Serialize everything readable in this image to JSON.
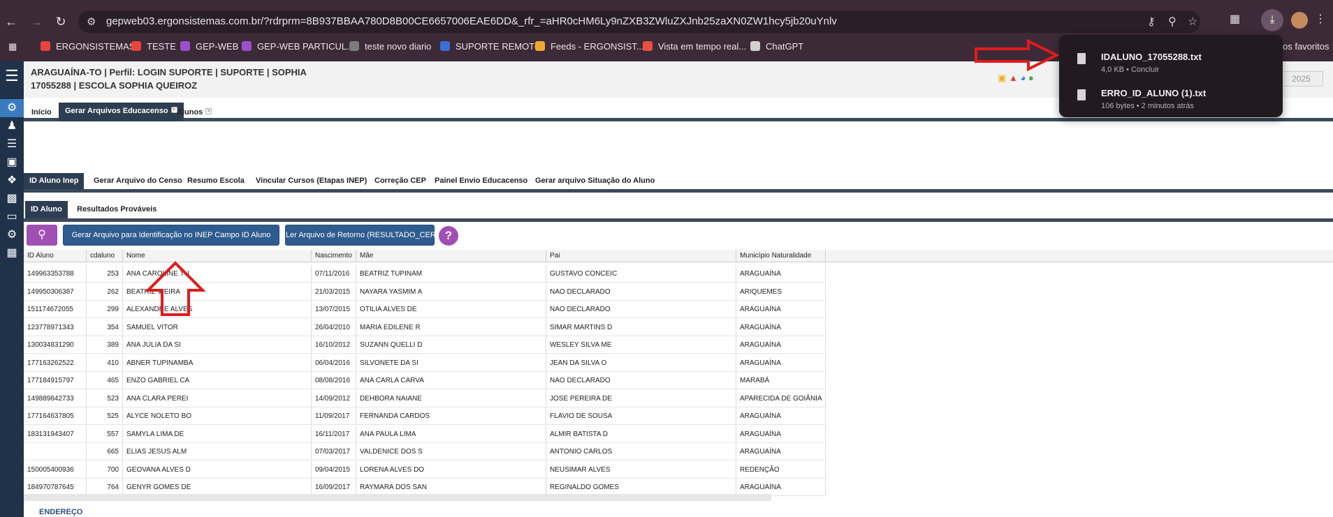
{
  "browser": {
    "url": "gepweb03.ergonsistemas.com.br/?rdrprm=8B937BBAA780D8B00CE6657006EAE6DD&_rfr_=aHR0cHM6Ly9nZXB3ZWluZXJnb25zaXN0ZW1hcy5jb20uYnlv",
    "bookmarks": [
      {
        "label": "ERGONSISTEMAS",
        "color": "#e8453c"
      },
      {
        "label": "TESTE",
        "color": "#e8453c"
      },
      {
        "label": "GEP-WEB",
        "color": "#9b4fd0"
      },
      {
        "label": "GEP-WEB PARTICUL...",
        "color": "#9b4fd0"
      },
      {
        "label": "teste novo diario",
        "color": "#7c7c7c"
      },
      {
        "label": "SUPORTE REMOTO",
        "color": "#3a6fd8"
      },
      {
        "label": "Feeds - ERGONSIST...",
        "color": "#f0a830"
      },
      {
        "label": "Vista em tempo real...",
        "color": "#e85040"
      },
      {
        "label": "ChatGPT",
        "color": "#d0d0d0"
      }
    ],
    "bookmarks_other": "os favoritos",
    "downloads": [
      {
        "name": "IDALUNO_17055288.txt",
        "meta": "4,0 KB • Concluir"
      },
      {
        "name": "ERRO_ID_ALUNO (1).txt",
        "meta": "106 bytes • 2 minutos atrás"
      }
    ]
  },
  "header": {
    "line1": "ARAGUAÍNA-TO | Perfil: LOGIN SUPORTE | SUPORTE | SOPHIA",
    "line2": "17055288 | ESCOLA SOPHIA QUEIROZ",
    "year": "2025"
  },
  "top_tabs": [
    {
      "label": "Início"
    },
    {
      "label": "Gerar Arquivos Educacenso"
    },
    {
      "label": "Alunos"
    }
  ],
  "module_tabs": [
    {
      "label": "ID Aluno Inep"
    },
    {
      "label": "Gerar Arquivo do Censo"
    },
    {
      "label": "Resumo Escola"
    },
    {
      "label": "Vincular Cursos (Etapas INEP)"
    },
    {
      "label": "Correção CEP"
    },
    {
      "label": "Painel Envio Educacenso"
    },
    {
      "label": "Gerar arquivo Situação do Aluno"
    }
  ],
  "sub_tabs": [
    {
      "label": "ID Aluno"
    },
    {
      "label": "Resultados Prováveis"
    }
  ],
  "toolbar": {
    "gen_label": "Gerar Arquivo para Identificação no INEP Campo ID Aluno",
    "read_label": "Ler Arquivo de Retorno (RESULTADO_CERTO.TXT)",
    "help_label": "?"
  },
  "table": {
    "columns": [
      "ID Aluno",
      "cdaluno",
      "Nome",
      "Nascimento",
      "Mãe",
      "Pai",
      "Município Naturalidade"
    ],
    "rows": [
      [
        "149963353788",
        "253",
        "ANA CAROLINE TU",
        "07/11/2016",
        "BEATRIZ TUPINAM",
        "GUSTAVO CONCEIC",
        "ARAGUAÍNA"
      ],
      [
        "149950306387",
        "262",
        "BEATRIZ VIEIRA",
        "21/03/2015",
        "NAYARA YASMIM A",
        "NAO DECLARADO",
        "ARIQUEMES"
      ],
      [
        "151174672055",
        "299",
        "ALEXANDRE ALVES",
        "13/07/2015",
        "OTILIA ALVES DE",
        "NAO DECLARADO",
        "ARAGUAÍNA"
      ],
      [
        "123778971343",
        "354",
        "SAMUEL VITOR",
        "26/04/2010",
        "MARIA EDILENE R",
        "SIMAR MARTINS D",
        "ARAGUAÍNA"
      ],
      [
        "130034831290",
        "389",
        "ANA JULIA DA SI",
        "16/10/2012",
        "SUZANN QUELLI D",
        "WESLEY SILVA ME",
        "ARAGUAÍNA"
      ],
      [
        "177163262522",
        "410",
        "ABNER TUPINAMBA",
        "06/04/2016",
        "SILVONETE DA SI",
        "JEAN DA SILVA O",
        "ARAGUAÍNA"
      ],
      [
        "177184915797",
        "465",
        "ENZO GABRIEL CA",
        "08/08/2016",
        "ANA CARLA CARVA",
        "NAO DECLARADO",
        "MARABÁ"
      ],
      [
        "149889842733",
        "523",
        "ANA CLARA PEREI",
        "14/09/2012",
        "DEHBORA NAIANE",
        "JOSE PEREIRA DE",
        "APARECIDA DE GOIÂNIA"
      ],
      [
        "177164637805",
        "525",
        "ALYCE NOLETO BO",
        "11/09/2017",
        "FERNANDA CARDOS",
        "FLAVIO DE SOUSA",
        "ARAGUAÍNA"
      ],
      [
        "183131943407",
        "557",
        "SAMYLA LIMA DE",
        "16/11/2017",
        "ANA PAULA LIMA",
        "ALMIR BATISTA D",
        "ARAGUAÍNA"
      ],
      [
        "",
        "665",
        "ELIAS JESUS ALM",
        "07/03/2017",
        "VALDENICE DOS S",
        "ANTONIO CARLOS",
        "ARAGUAÍNA"
      ],
      [
        "150005400936",
        "700",
        "GEOVANA ALVES D",
        "09/04/2015",
        "LORENA ALVES DO",
        "NEUSIMAR ALVES",
        "REDENÇÃO"
      ],
      [
        "184970787645",
        "764",
        "GENYR GOMES DE",
        "16/09/2017",
        "RAYMARA DOS SAN",
        "REGINALDO GOMES",
        "ARAGUAÍNA"
      ]
    ]
  },
  "footer": {
    "section_label": "ENDEREÇO"
  },
  "colors": {
    "accent_purple": "#a04fb5",
    "button_blue": "#2f5c8f",
    "tab_dark": "#2e3e52",
    "annotation_red": "#e01b1b"
  }
}
